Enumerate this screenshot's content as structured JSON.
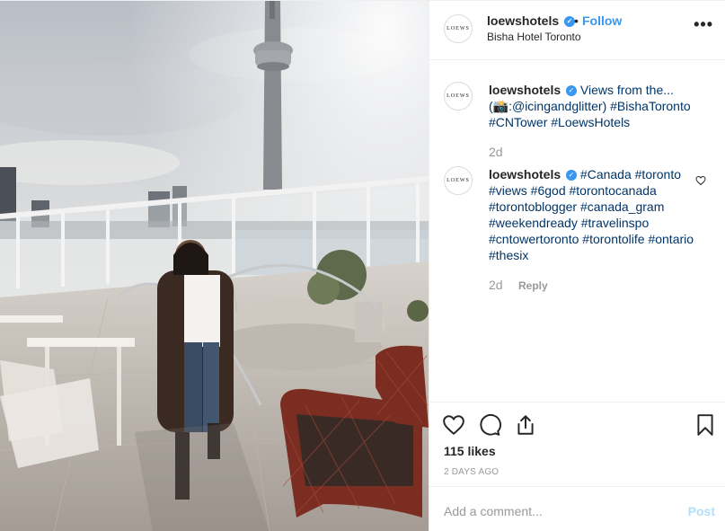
{
  "header": {
    "avatar_text": "LOEWS",
    "username": "loewshotels",
    "separator": "•",
    "follow_label": "Follow",
    "location": "Bisha Hotel Toronto",
    "more_label": "•••"
  },
  "comments": [
    {
      "avatar_text": "LOEWS",
      "username": "loewshotels",
      "text": "Views from the... (📸:@icingandglitter) #BishaToronto #CNTower #LoewsHotels",
      "time": "2d"
    },
    {
      "avatar_text": "LOEWS",
      "username": "loewshotels",
      "text": "#Canada #toronto #views #6god #torontocanada #torontoblogger #canada_gram #weekendready #travelinspo #cntowertoronto #torontolife #ontario #thesix",
      "time": "2d",
      "reply_label": "Reply"
    }
  ],
  "actions": {
    "icons": [
      "heart-icon",
      "comment-icon",
      "share-icon",
      "bookmark-icon"
    ],
    "likes": "115 likes",
    "date": "2 DAYS AGO"
  },
  "add_comment": {
    "placeholder": "Add a comment...",
    "post_label": "Post"
  },
  "colors": {
    "link": "#003569",
    "follow": "#3897f0",
    "muted": "#999999",
    "post_disabled": "#b2dffc"
  }
}
